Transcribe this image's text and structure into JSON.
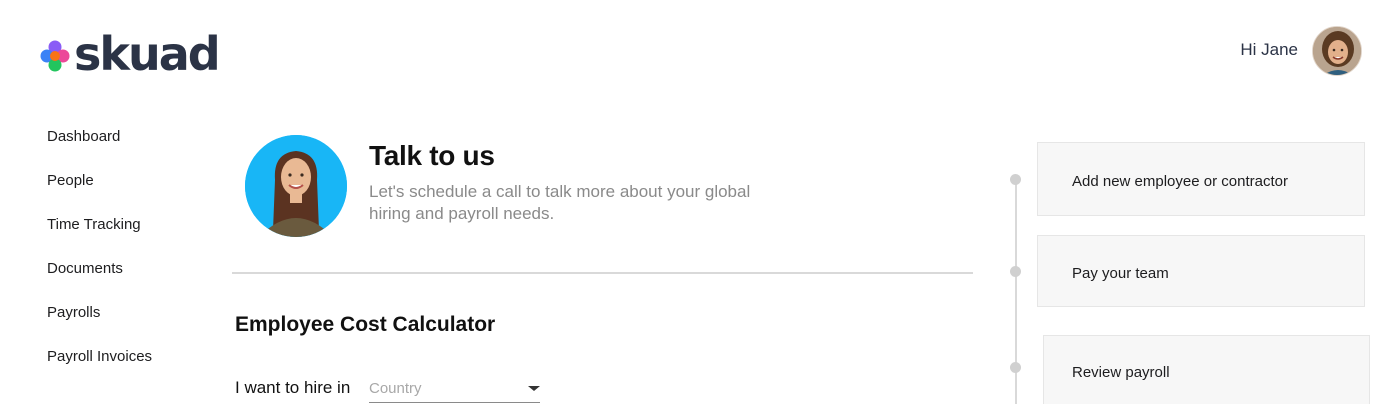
{
  "header": {
    "logo_text": "skuad",
    "greeting": "Hi Jane",
    "avatar_icon": "user-avatar-photo"
  },
  "sidebar": {
    "items": [
      {
        "label": "Dashboard"
      },
      {
        "label": "People"
      },
      {
        "label": "Time Tracking"
      },
      {
        "label": "Documents"
      },
      {
        "label": "Payrolls"
      },
      {
        "label": "Payroll Invoices"
      }
    ]
  },
  "talk": {
    "title": "Talk to us",
    "subtitle": "Let's schedule a call to talk more about your global hiring and payroll needs."
  },
  "calculator": {
    "title": "Employee Cost Calculator",
    "hire_label": "I want to hire in",
    "country_placeholder": "Country"
  },
  "steps": [
    {
      "label": "Add new employee or contractor"
    },
    {
      "label": "Pay your team"
    },
    {
      "label": "Review payroll"
    }
  ],
  "colors": {
    "brand_text": "#2b3346",
    "logo_purple": "#8a5cf6",
    "logo_blue": "#3b82f6",
    "logo_green": "#22c55e",
    "logo_orange": "#f97316",
    "logo_pink": "#ec4899",
    "photo_background": "#18b6f6"
  }
}
